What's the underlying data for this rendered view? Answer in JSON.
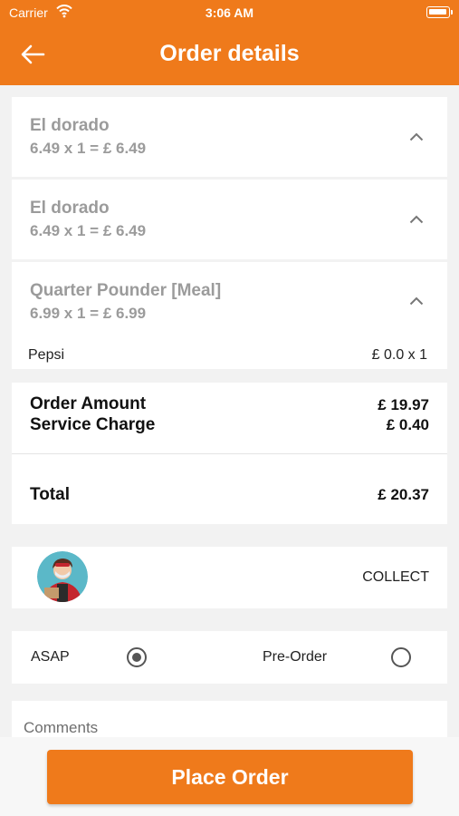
{
  "status_bar": {
    "carrier": "Carrier",
    "time": "3:06 AM"
  },
  "header": {
    "title": "Order details",
    "back_icon": "arrow-left-icon"
  },
  "items": [
    {
      "name": "El dorado",
      "calc": "6.49 x 1 = £ 6.49"
    },
    {
      "name": "El dorado",
      "calc": "6.49 x 1 = £ 6.49"
    },
    {
      "name": "Quarter Pounder [Meal]",
      "calc": "6.99 x 1 = £ 6.99",
      "extras": [
        {
          "name": "Pepsi",
          "price": "£ 0.0 x 1"
        }
      ]
    }
  ],
  "summary": {
    "order_amount_label": "Order Amount",
    "order_amount": "£ 19.97",
    "service_charge_label": "Service Charge",
    "service_charge": "£ 0.40",
    "total_label": "Total",
    "total": "£ 20.37"
  },
  "delivery": {
    "mode": "COLLECT"
  },
  "timing": {
    "asap_label": "ASAP",
    "preorder_label": "Pre-Order",
    "selected": "ASAP"
  },
  "comments": {
    "placeholder": "Comments"
  },
  "footer": {
    "place_order_label": "Place Order"
  },
  "colors": {
    "accent": "#ef7a1b",
    "muted_text": "#9b9b9b"
  }
}
